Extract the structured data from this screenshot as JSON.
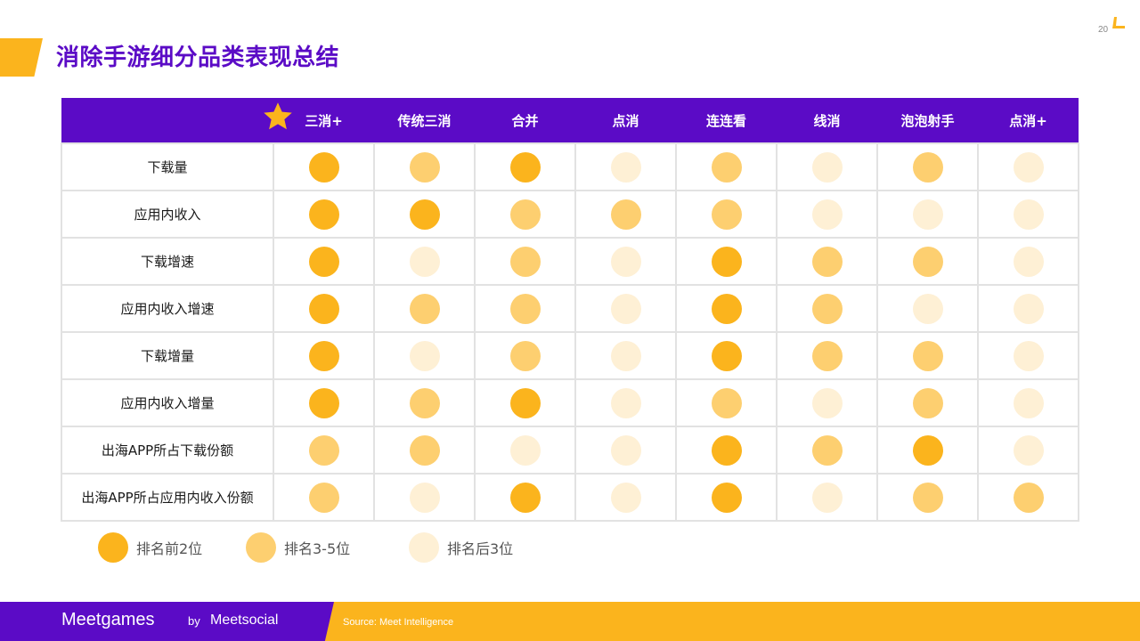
{
  "page": {
    "title": "消除手游细分品类表现总结",
    "page_number": "20"
  },
  "colors": {
    "accent": "#FBB41D",
    "brand_purple": "#5B0BC6",
    "level_top2": "#FBB41D",
    "level_3_5": "#FDCF70",
    "level_bottom3": "#FEF0D5"
  },
  "table": {
    "columns": [
      "三消+",
      "传统三消",
      "合并",
      "点消",
      "连连看",
      "线消",
      "泡泡射手",
      "点消+"
    ],
    "highlight_column_icon": "star-icon",
    "rows": [
      {
        "label": "下载量",
        "levels": [
          1,
          2,
          1,
          3,
          2,
          3,
          2,
          3
        ]
      },
      {
        "label": "应用内收入",
        "levels": [
          1,
          1,
          2,
          2,
          2,
          3,
          3,
          3
        ]
      },
      {
        "label": "下载增速",
        "levels": [
          1,
          3,
          2,
          3,
          1,
          2,
          2,
          3
        ]
      },
      {
        "label": "应用内收入增速",
        "levels": [
          1,
          2,
          2,
          3,
          1,
          2,
          3,
          3
        ]
      },
      {
        "label": "下载增量",
        "levels": [
          1,
          3,
          2,
          3,
          1,
          2,
          2,
          3
        ]
      },
      {
        "label": "应用内收入增量",
        "levels": [
          1,
          2,
          1,
          3,
          2,
          3,
          2,
          3
        ]
      },
      {
        "label": "出海APP所占下载份额",
        "levels": [
          2,
          2,
          3,
          3,
          1,
          2,
          1,
          3
        ]
      },
      {
        "label": "出海APP所占应用内收入份额",
        "levels": [
          2,
          3,
          1,
          3,
          1,
          3,
          2,
          2
        ]
      }
    ]
  },
  "legend": [
    {
      "label": "排名前2位",
      "level": 1
    },
    {
      "label": "排名3-5位",
      "level": 2
    },
    {
      "label": "排名后3位",
      "level": 3
    }
  ],
  "footer": {
    "brand": "Meetgames",
    "by": "by",
    "partner": "Meetsocial",
    "source": "Source: Meet Intelligence"
  }
}
